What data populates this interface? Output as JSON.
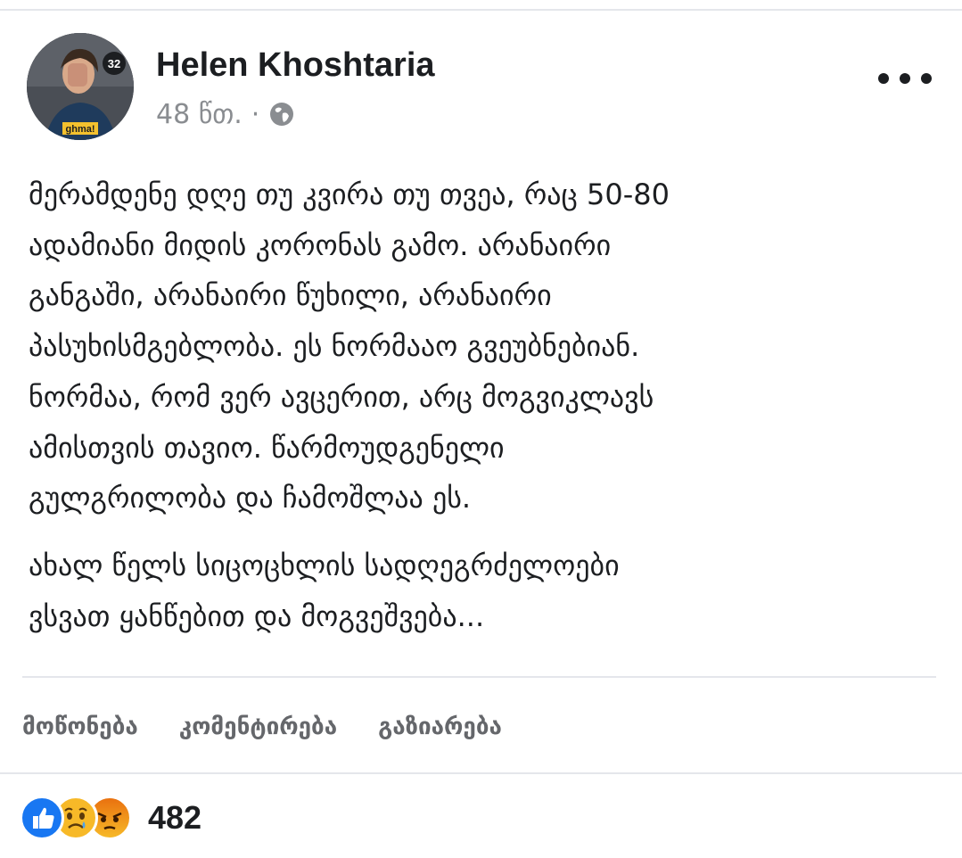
{
  "post": {
    "author": "Helen Khoshtaria",
    "time": "48 წთ.",
    "separator": "·",
    "avatar_badge_number": "32",
    "avatar_badge_text": "ghma!",
    "paragraphs": [
      "მერამდენე დღე თუ კვირა თუ თვეა, რაც 50-80\nადამიანი მიდის კორონას გამო. არანაირი\nგანგაში, არანაირი წუხილი, არანაირი\nპასუხისმგებლობა. ეს ნორმააო გვეუბნებიან.\nნორმაა, რომ ვერ ავცერით, არც მოგვიკლავს\nამისთვის თავიო. წარმოუდგენელი\nგულგრილობა და ჩამოშლაა ეს.",
      "ახალ წელს სიცოცხლის სადღეგრძელოები\nვსვათ ყანწებით და მოგვეშვება..."
    ],
    "privacy_icon": "globe-icon",
    "more_icon": "more-options-icon"
  },
  "actions": {
    "like": "მოწონება",
    "comment": "კომენტირება",
    "share": "გაზიარება"
  },
  "reactions": {
    "icons": [
      "like-icon",
      "sad-icon",
      "angry-icon"
    ],
    "count": "482"
  },
  "colors": {
    "text": "#1c1e21",
    "muted": "#65676b",
    "meta": "#8a8d91",
    "like_blue": "#1877f2",
    "reaction_yellow": "#f7b928",
    "angry_orange": "#e9710f",
    "divider": "#e4e6eb"
  }
}
